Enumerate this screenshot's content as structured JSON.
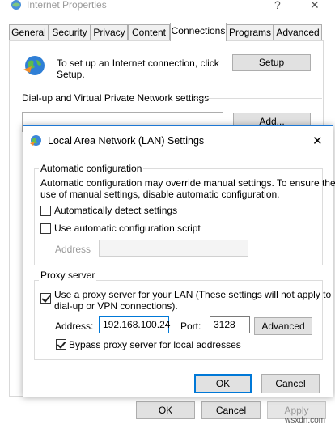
{
  "window": {
    "title": "Internet Properties",
    "close_glyph": "✕",
    "help_glyph": "?"
  },
  "tabs": [
    {
      "label": "General"
    },
    {
      "label": "Security"
    },
    {
      "label": "Privacy"
    },
    {
      "label": "Content"
    },
    {
      "label": "Connections"
    },
    {
      "label": "Programs"
    },
    {
      "label": "Advanced"
    }
  ],
  "connections": {
    "setup_text_line1": "To set up an Internet connection, click",
    "setup_text_line2": "Setup.",
    "setup_button": "Setup",
    "vpn_section_label": "Dial-up and Virtual Private Network settings",
    "add_button": "Add..."
  },
  "main_buttons": {
    "ok": "OK",
    "cancel": "Cancel",
    "apply": "Apply"
  },
  "lan_dialog": {
    "title": "Local Area Network (LAN) Settings",
    "close_glyph": "✕",
    "auto_config": {
      "heading": "Automatic configuration",
      "description_line1": "Automatic configuration may override manual settings.  To ensure the",
      "description_line2": "use of manual settings, disable automatic configuration.",
      "auto_detect_label": "Automatically detect settings",
      "auto_detect_checked": false,
      "use_script_label": "Use automatic configuration script",
      "use_script_checked": false,
      "address_label": "Address",
      "address_value": ""
    },
    "proxy": {
      "heading": "Proxy server",
      "use_proxy_line1": "Use a proxy server for your LAN (These settings will not apply to",
      "use_proxy_line2": "dial-up or VPN connections).",
      "use_proxy_checked": true,
      "address_label": "Address:",
      "address_value": "192.168.100.24",
      "port_label": "Port:",
      "port_value": "3128",
      "advanced_button": "Advanced",
      "bypass_label": "Bypass proxy server for local addresses",
      "bypass_checked": true
    },
    "ok_button": "OK",
    "cancel_button": "Cancel"
  },
  "watermark": "wsxdn.com"
}
